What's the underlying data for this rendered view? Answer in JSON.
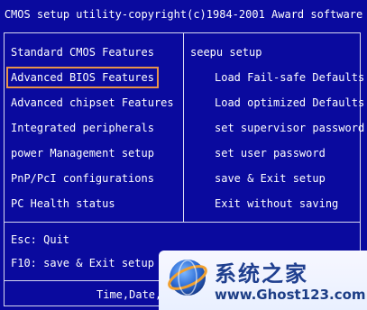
{
  "header": {
    "title": "CMOS setup utility-copyright(c)1984-2001 Award software"
  },
  "left_menu": [
    "Standard CMOS Features",
    "Advanced BIOS Features",
    "Advanced chipset Features",
    "Integrated peripherals",
    "power Management setup",
    "PnP/PcI configurations",
    "PC Health status"
  ],
  "right_menu": [
    "seepu setup",
    "Load Fail-safe Defaults",
    "Load optimized Defaults",
    "set supervisor password",
    "set user password",
    "save & Exit setup",
    "Exit without saving"
  ],
  "selected_item": "Advanced BIOS Features",
  "footer": {
    "esc": "Esc: Quit",
    "f10": "F10: save & Exit setup",
    "status": "Time,Date,"
  },
  "watermark": {
    "text_cn": "系统之家",
    "url": "www.Ghost123.com"
  },
  "colors": {
    "background": "#0a0a9e",
    "selection_outline": "#e8934a"
  }
}
